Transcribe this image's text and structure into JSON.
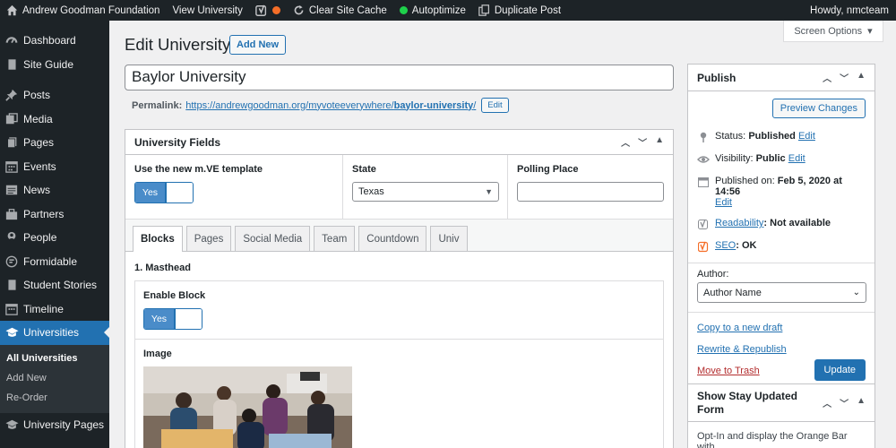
{
  "adminbar": {
    "site_name": "Andrew Goodman Foundation",
    "view_university": "View University",
    "clear_cache": "Clear Site Cache",
    "autoptimize": "Autoptimize",
    "duplicate_post": "Duplicate Post",
    "howdy": "Howdy, nmcteam"
  },
  "sidebar": {
    "items": [
      {
        "label": "Dashboard",
        "icon": "dashboard-icon"
      },
      {
        "label": "Site Guide",
        "icon": "book-icon"
      },
      {
        "label": "Posts",
        "icon": "pin-icon"
      },
      {
        "label": "Media",
        "icon": "media-icon"
      },
      {
        "label": "Pages",
        "icon": "pages-icon"
      },
      {
        "label": "Events",
        "icon": "calendar-icon"
      },
      {
        "label": "News",
        "icon": "news-icon"
      },
      {
        "label": "Partners",
        "icon": "partners-icon"
      },
      {
        "label": "People",
        "icon": "people-icon"
      },
      {
        "label": "Formidable",
        "icon": "formidable-icon"
      },
      {
        "label": "Student Stories",
        "icon": "book-icon"
      },
      {
        "label": "Timeline",
        "icon": "calendar-icon"
      },
      {
        "label": "Universities",
        "icon": "graduation-cap-icon"
      },
      {
        "label": "University Pages",
        "icon": "graduation-cap-icon"
      }
    ],
    "submenu": [
      "All Universities",
      "Add New",
      "Re-Order"
    ]
  },
  "main": {
    "page_title": "Edit University",
    "add_new": "Add New",
    "screen_options": "Screen Options",
    "post_title": "Baylor University",
    "permalink_label": "Permalink:",
    "permalink_base": "https://andrewgoodman.org/myvoteeverywhere/",
    "permalink_slug": "baylor-university",
    "permalink_trail": "/",
    "permalink_edit": "Edit"
  },
  "fields_box": {
    "title": "University Fields",
    "mve_label": "Use the new m.VE template",
    "mve_value": "Yes",
    "state_label": "State",
    "state_value": "Texas",
    "polling_label": "Polling Place",
    "polling_value": "",
    "tabs": [
      "Blocks",
      "Pages",
      "Social Media",
      "Team",
      "Countdown",
      "Univ"
    ],
    "masthead": "1. Masthead",
    "enable_block_label": "Enable Block",
    "enable_block_value": "Yes",
    "image_label": "Image"
  },
  "publish": {
    "title": "Publish",
    "preview": "Preview Changes",
    "status_label": "Status:",
    "status_value": "Published",
    "visibility_label": "Visibility:",
    "visibility_value": "Public",
    "published_label": "Published on:",
    "published_value": "Feb 5, 2020 at 14:56",
    "edit": "Edit",
    "readability_link": "Readability",
    "readability_value": ": Not available",
    "seo_link": "SEO",
    "seo_value": ": OK",
    "author_label": "Author:",
    "author_value": "Author Name",
    "copy_draft": "Copy to a new draft",
    "rewrite": "Rewrite & Republish",
    "trash": "Move to Trash",
    "update": "Update"
  },
  "stay_updated": {
    "title": "Show Stay Updated Form",
    "desc": "Opt-In and display the Orange Bar with"
  },
  "colors": {
    "admin_dark": "#1d2327",
    "accent": "#2271b1",
    "status_dot": "#f56e28",
    "autoptimize_dot": "#1ed14b",
    "danger": "#b32d2e"
  }
}
